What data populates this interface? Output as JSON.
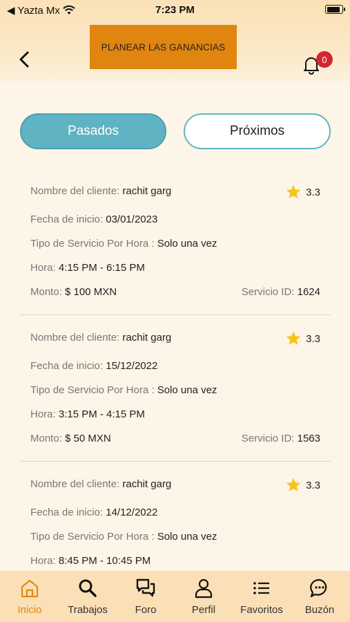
{
  "status_bar": {
    "carrier": "◀ Yazta Mx",
    "time": "7:23 PM",
    "battery_level": 0.9
  },
  "header": {
    "banner_text": "PLANEAR LAS GANANCIAS",
    "notification_count": "0"
  },
  "tabs": {
    "past": "Pasados",
    "upcoming": "Próximos"
  },
  "labels": {
    "client": "Nombre del cliente:",
    "start_date": "Fecha de inicio:",
    "service_type": "Tipo de Servicio Por Hora :",
    "hour": "Hora:",
    "amount": "Monto:",
    "service_id": "Servicio ID:"
  },
  "bookings": [
    {
      "client": "rachit garg",
      "rating": "3.3",
      "start_date": "03/01/2023",
      "service_type": "Solo una vez",
      "hour": "4:15 PM - 6:15 PM",
      "amount": "$ 100 MXN",
      "service_id": "1624"
    },
    {
      "client": "rachit garg",
      "rating": "3.3",
      "start_date": "15/12/2022",
      "service_type": "Solo una vez",
      "hour": "3:15 PM - 4:15 PM",
      "amount": "$ 50 MXN",
      "service_id": "1563"
    },
    {
      "client": "rachit garg",
      "rating": "3.3",
      "start_date": "14/12/2022",
      "service_type": "Solo una vez",
      "hour": "8:45 PM - 10:45 PM",
      "amount": "",
      "service_id": ""
    }
  ],
  "nav": [
    {
      "label": "Inicio",
      "icon": "home-icon",
      "active": true
    },
    {
      "label": "Trabajos",
      "icon": "search-icon",
      "active": false
    },
    {
      "label": "Foro",
      "icon": "chat-bubbles-icon",
      "active": false
    },
    {
      "label": "Perfil",
      "icon": "person-icon",
      "active": false
    },
    {
      "label": "Favoritos",
      "icon": "list-icon",
      "active": false
    },
    {
      "label": "Buzón",
      "icon": "message-icon",
      "active": false
    }
  ],
  "colors": {
    "accent": "#e08a10",
    "tab_active": "#5fb3c3",
    "star": "#f5c51c",
    "badge": "#d3262f"
  }
}
